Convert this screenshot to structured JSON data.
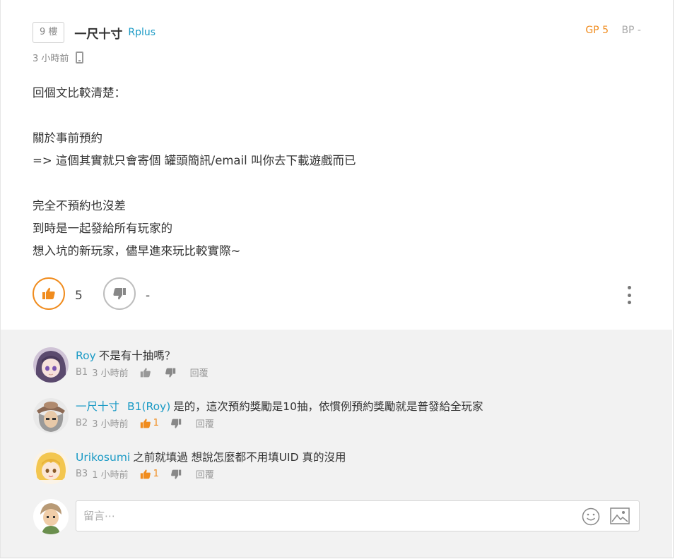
{
  "post": {
    "floor": "9 樓",
    "author": "一尺十寸",
    "author_id": "Rplus",
    "gp": "GP 5",
    "bp": "BP -",
    "time": "3 小時前",
    "content_lines": [
      "回個文比較清楚：",
      "",
      "關於事前預約",
      "=> 這個其實就只會寄個 罐頭簡訊/email 叫你去下載遊戲而已",
      "",
      "完全不預約也沒差",
      "到時是一起發給所有玩家的",
      "想入坑的新玩家，儘早進來玩比較實際~"
    ],
    "like_count": "5",
    "dislike_count": "-"
  },
  "comments": [
    {
      "name": "Roy",
      "text": "不是有十抽嗎？",
      "floor": "B1",
      "time": "3 小時前",
      "likes": "",
      "reply": "回覆"
    },
    {
      "name": "一尺十寸",
      "mention": "B1(Roy)",
      "text": "是的，這次預約獎勵是10抽，依慣例預約獎勵就是普發給全玩家",
      "floor": "B2",
      "time": "3 小時前",
      "likes": "1",
      "reply": "回覆"
    },
    {
      "name": "Urikosumi",
      "text": "之前就填過 想說怎麼都不用填UID 真的沒用",
      "floor": "B3",
      "time": "1 小時前",
      "likes": "1",
      "reply": "回覆"
    }
  ],
  "reply_box": {
    "placeholder": "留言⋯"
  },
  "colors": {
    "accent": "#f08c1e",
    "link": "#1a9ac5",
    "comment_bg": "#f2f2f2"
  }
}
